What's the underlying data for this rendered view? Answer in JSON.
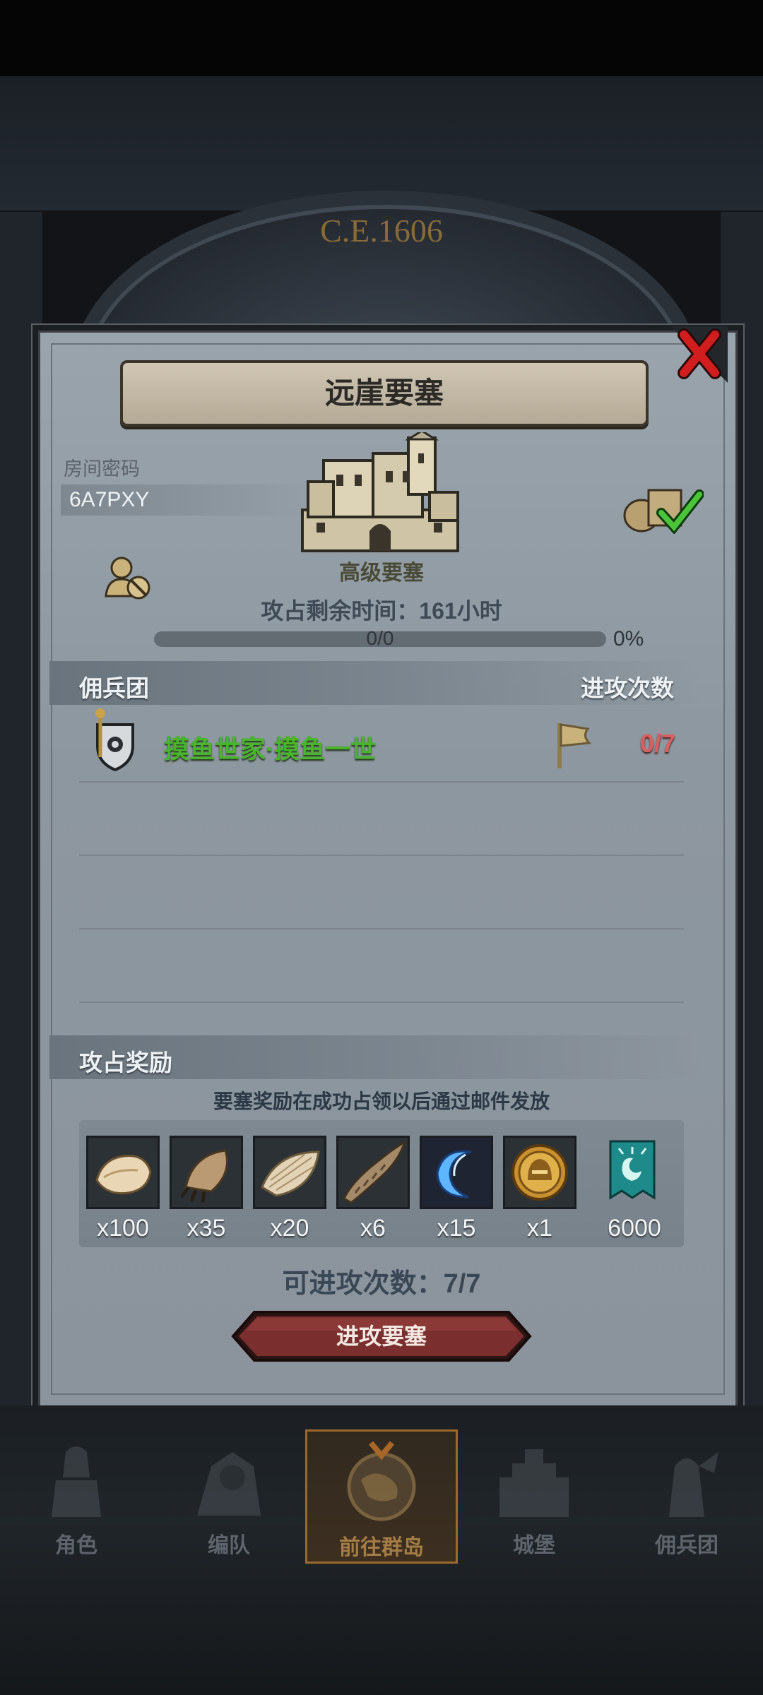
{
  "background": {
    "era_title": "C.E.1606"
  },
  "dialog": {
    "title": "远崖要塞",
    "room": {
      "label": "房间密码",
      "code": "6A7PXY"
    },
    "fortress_type": "高级要塞",
    "time_label": "攻占剩余时间：",
    "time_value": "161",
    "time_unit": "小时",
    "progress": {
      "text": "0/0",
      "percent_text": "0%",
      "fraction": 0
    },
    "mercenary": {
      "header": "佣兵团",
      "attack_header": "进攻次数",
      "rows": [
        {
          "name": "摸鱼世家·摸鱼一世",
          "attacks": "0/7"
        }
      ]
    },
    "rewards": {
      "header": "攻占奖励",
      "notice": "要塞奖励在成功占领以后通过邮件发放",
      "items": [
        {
          "icon": "fur-pelt-icon",
          "count": "x100"
        },
        {
          "icon": "beast-claw-icon",
          "count": "x35"
        },
        {
          "icon": "feather-hide-icon",
          "count": "x20"
        },
        {
          "icon": "horn-icon",
          "count": "x6"
        },
        {
          "icon": "blue-crescent-icon",
          "count": "x15"
        },
        {
          "icon": "golden-helmet-medal-icon",
          "count": "x1"
        },
        {
          "icon": "guild-banner-icon",
          "count": "6000"
        }
      ]
    },
    "attempts_label": "可进攻次数：",
    "attempts_value": "7/7",
    "attack_button": "进攻要塞"
  },
  "bottom_nav": [
    {
      "label": "角色",
      "icon": "knight-icon"
    },
    {
      "label": "编队",
      "icon": "formation-icon"
    },
    {
      "label": "前往群岛",
      "icon": "globe-icon",
      "active": true
    },
    {
      "label": "城堡",
      "icon": "castle-icon"
    },
    {
      "label": "佣兵团",
      "icon": "mercenary-icon"
    }
  ],
  "colors": {
    "guild_name": "#48b52c",
    "attack_count": "#d96060",
    "active_nav": "#9a6a2c",
    "close_button": "#d01e1e"
  }
}
